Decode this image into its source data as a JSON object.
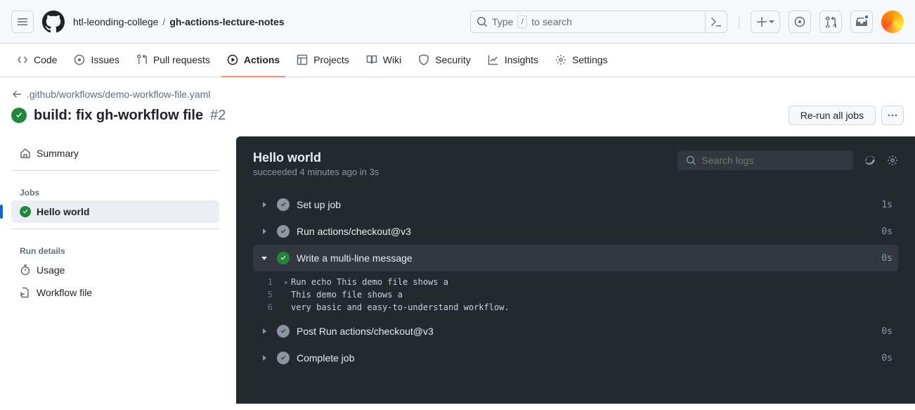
{
  "breadcrumb": {
    "org": "htl-leonding-college",
    "repo": "gh-actions-lecture-notes",
    "sep": "/"
  },
  "search": {
    "placeholder_pre": "Type",
    "placeholder_key": "/",
    "placeholder_post": "to search"
  },
  "nav": {
    "code": "Code",
    "issues": "Issues",
    "pulls": "Pull requests",
    "actions": "Actions",
    "projects": "Projects",
    "wiki": "Wiki",
    "security": "Security",
    "insights": "Insights",
    "settings": "Settings"
  },
  "back": {
    "path": ".github/workflows/demo-workflow-file.yaml"
  },
  "run": {
    "title": "build: fix gh-workflow file",
    "number": "#2",
    "rerun": "Re-run all jobs"
  },
  "sidebar": {
    "summary": "Summary",
    "jobs_heading": "Jobs",
    "job1": "Hello world",
    "details_heading": "Run details",
    "usage": "Usage",
    "workflow_file": "Workflow file"
  },
  "log": {
    "title": "Hello world",
    "status": "succeeded 4 minutes ago in 3s",
    "search_placeholder": "Search logs",
    "steps": {
      "s0": {
        "name": "Set up job",
        "time": "1s"
      },
      "s1": {
        "name": "Run actions/checkout@v3",
        "time": "0s"
      },
      "s2": {
        "name": "Write a multi-line message",
        "time": "0s"
      },
      "s3": {
        "name": "Post Run actions/checkout@v3",
        "time": "0s"
      },
      "s4": {
        "name": "Complete job",
        "time": "0s"
      }
    },
    "lines": {
      "l1": {
        "n": "1",
        "t": "Run echo This demo file shows a"
      },
      "l5": {
        "n": "5",
        "t": "This demo file shows a"
      },
      "l6": {
        "n": "6",
        "t": "very basic and easy-to-understand workflow."
      }
    }
  }
}
